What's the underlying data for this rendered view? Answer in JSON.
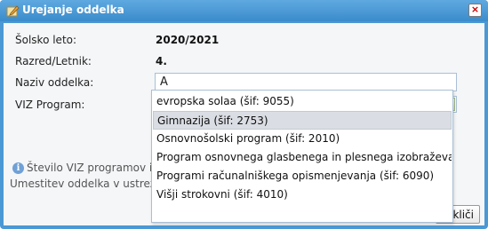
{
  "window": {
    "title": "Urejanje oddelka",
    "close_glyph": "×"
  },
  "form": {
    "school_year_label": "Šolsko leto:",
    "school_year_value": "2020/2021",
    "grade_label": "Razred/Letnik:",
    "grade_value": "4.",
    "department_name_label": "Naziv oddelka:",
    "department_name_value": "A",
    "viz_program_label": "VIZ Program:",
    "viz_program_value": ""
  },
  "dropdown": {
    "options": [
      "evropska solaa (šif: 9055)",
      "Gimnazija (šif: 2753)",
      "Osnovnošolski program (šif: 2010)",
      "Program osnovnega glasbenega in plesnega izobraževanja...",
      "Programi računalniškega opismenjevanja (šif: 6090)",
      "Višji strokovni (šif: 4010)"
    ],
    "selected_index": 1
  },
  "info": {
    "line1": "Število VIZ programov iz",
    "line2": "Umestitev oddelka v ustrezen"
  },
  "footer": {
    "close_label": "kliči"
  },
  "colors": {
    "titlebar": "#3b8bcb",
    "selected_option": "#dadde3",
    "select_arrow": "#5a8a2a"
  }
}
